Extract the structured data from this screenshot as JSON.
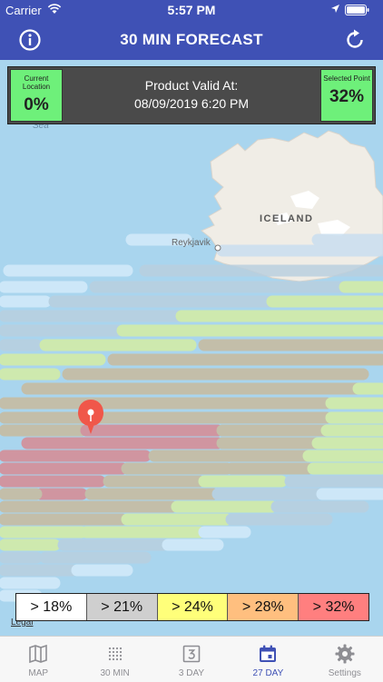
{
  "status_bar": {
    "carrier": "Carrier",
    "time": "5:57 PM"
  },
  "nav": {
    "title": "30 MIN FORECAST"
  },
  "panel": {
    "current_location_label": "Current Location",
    "current_location_value": "0%",
    "valid_label": "Product Valid At:",
    "valid_time": "08/09/2019 6:20 PM",
    "selected_point_label": "Selected Point",
    "selected_point_value": "32%"
  },
  "map": {
    "sea_label": "Sea",
    "country_label": "ICELAND",
    "city_label": "Reykjavik",
    "legal_link": "Legal"
  },
  "legend": [
    {
      "label": "> 18%",
      "color": "#ffffff"
    },
    {
      "label": "> 21%",
      "color": "#cfcfcf"
    },
    {
      "label": "> 24%",
      "color": "#ffff7a"
    },
    {
      "label": "> 28%",
      "color": "#ffbf7f"
    },
    {
      "label": "> 32%",
      "color": "#ff7f7f"
    }
  ],
  "tabs": [
    {
      "label": "MAP",
      "icon": "map-icon"
    },
    {
      "label": "30 MIN",
      "icon": "dots-grid-icon"
    },
    {
      "label": "3 DAY",
      "icon": "three-day-icon"
    },
    {
      "label": "27 DAY",
      "icon": "calendar-icon"
    },
    {
      "label": "Settings",
      "icon": "gear-icon"
    }
  ],
  "colors": {
    "nav_bg": "#3f51b5",
    "value_box": "#6ef07a",
    "panel_bg": "#4a4a4a",
    "active_tab": "#3f51b5",
    "inactive_tab": "#8e8e93"
  }
}
